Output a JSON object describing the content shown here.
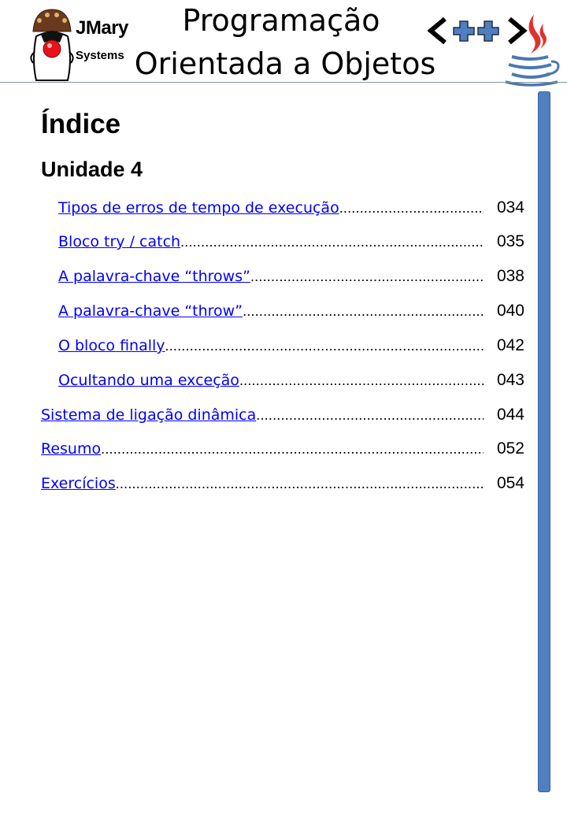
{
  "header": {
    "logo": {
      "name": "JMary",
      "sub": "Systems"
    },
    "title_line1": "Programação",
    "title_line2": "Orientada a Objetos",
    "cpp_mark": "<++>"
  },
  "index_title": "Índice",
  "unit_title": "Unidade 4",
  "toc": [
    {
      "label": "Tipos de erros de tempo de execução",
      "page": "034"
    },
    {
      "label": "Bloco try / catch",
      "page": "035"
    },
    {
      "label": "A palavra-chave “throws”",
      "page": "038"
    },
    {
      "label": "A palavra-chave “throw”",
      "page": "040"
    },
    {
      "label": "O bloco finally",
      "page": "042"
    },
    {
      "label": "Ocultando uma exceção",
      "page": "043"
    },
    {
      "label": "Sistema de ligação dinâmica",
      "page": "044"
    },
    {
      "label": "Resumo",
      "page": "052"
    },
    {
      "label": "Exercícios ",
      "page": "054"
    }
  ],
  "colors": {
    "link": "#0000ff",
    "side_bar": "#4f7fc0",
    "cpp_plus": "#4f7fc0",
    "java_flame": "#e0312b",
    "java_cup": "#4a77b4"
  }
}
